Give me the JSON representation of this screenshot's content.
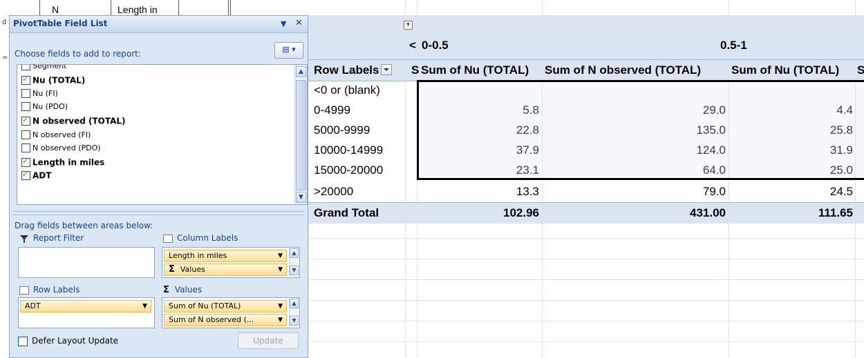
{
  "top_strip": {
    "text1": "N",
    "text2": "Length in"
  },
  "field_list": {
    "title": "PivotTable Field List",
    "dropdown_glyph": "▼",
    "close_glyph": "✕",
    "choose_label": "Choose fields to add to report:",
    "layout_button_icon": "layout-icon",
    "fields": [
      {
        "label": "Segment",
        "checked": false,
        "bold": false
      },
      {
        "label": "Nu (TOTAL)",
        "checked": true,
        "bold": true
      },
      {
        "label": "Nu (FI)",
        "checked": false,
        "bold": false
      },
      {
        "label": "Nu (PDO)",
        "checked": false,
        "bold": false
      },
      {
        "label": "N observed (TOTAL)",
        "checked": true,
        "bold": true
      },
      {
        "label": "N observed (FI)",
        "checked": false,
        "bold": false
      },
      {
        "label": "N observed (PDO)",
        "checked": false,
        "bold": false
      },
      {
        "label": "Length in miles",
        "checked": true,
        "bold": true
      },
      {
        "label": "ADT",
        "checked": true,
        "bold": true
      }
    ],
    "drag_label": "Drag fields between areas below:",
    "report_filter_label": "Report Filter",
    "column_labels_label": "Column Labels",
    "row_labels_label": "Row Labels",
    "values_label": "Values",
    "column_chips": [
      "Length in miles",
      "Values"
    ],
    "row_chips": [
      "ADT"
    ],
    "value_chips": [
      "Sum of Nu (TOTAL)",
      "Sum of N observed (..."
    ],
    "defer_label": "Defer Layout Update",
    "update_label": "Update"
  },
  "pivot": {
    "col_group_cut": "<",
    "col_group_1": "0-0.5",
    "col_group_2": "0.5-1",
    "row_labels_header": "Row Labels",
    "row_labels_next_cut": "S",
    "headers": [
      "Sum of Nu (TOTAL)",
      "Sum of N observed (TOTAL)",
      "Sum of Nu (TOTAL)",
      "S"
    ],
    "rows": [
      {
        "label": "<0 or (blank)",
        "v1": "",
        "v2": "",
        "v3": ""
      },
      {
        "label": "0-4999",
        "v1": "5.8",
        "v2": "29.0",
        "v3": "4.4"
      },
      {
        "label": "5000-9999",
        "v1": "22.8",
        "v2": "135.0",
        "v3": "25.8"
      },
      {
        "label": "10000-14999",
        "v1": "37.9",
        "v2": "124.0",
        "v3": "31.9"
      },
      {
        "label": "15000-20000",
        "v1": "23.1",
        "v2": "64.0",
        "v3": "25.0"
      },
      {
        "label": ">20000",
        "v1": "13.3",
        "v2": "79.0",
        "v3": "24.5"
      }
    ],
    "grand_total": {
      "label": "Grand Total",
      "v1": "102.96",
      "v2": "431.00",
      "v3": "111.65"
    }
  },
  "colors": {
    "pane_bg": "#dce7f5",
    "header_band": "#dbe5f1",
    "chip": "#ffdc8e",
    "check": "#21a121"
  }
}
